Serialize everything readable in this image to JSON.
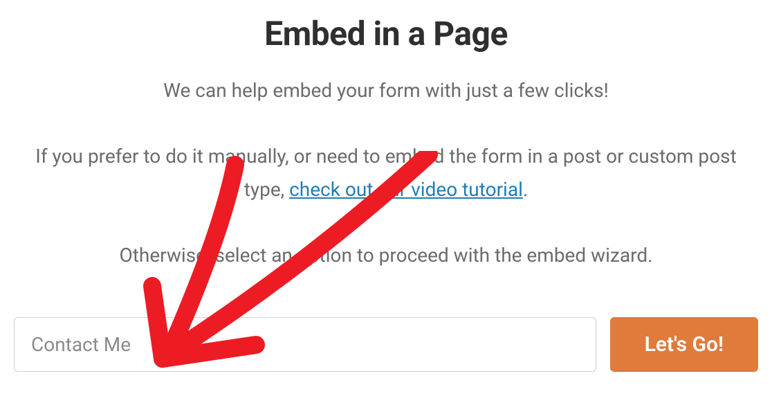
{
  "dialog": {
    "title": "Embed in a Page",
    "intro": "We can help embed your form with just a few clicks!",
    "manual_prefix": "If you prefer to do it manually, or need to embed the form in a post or custom post type, ",
    "video_link_text": "check out our video tutorial",
    "manual_suffix": ".",
    "wizard_prompt": "Otherwise, select an option to proceed with the embed wizard."
  },
  "form": {
    "page_input_value": "Contact Me",
    "go_button_label": "Let's Go!"
  },
  "colors": {
    "accent": "#e07b3c",
    "link": "#1e7db8",
    "text_dark": "#2f2f2f",
    "text_muted": "#6b6b6b"
  }
}
